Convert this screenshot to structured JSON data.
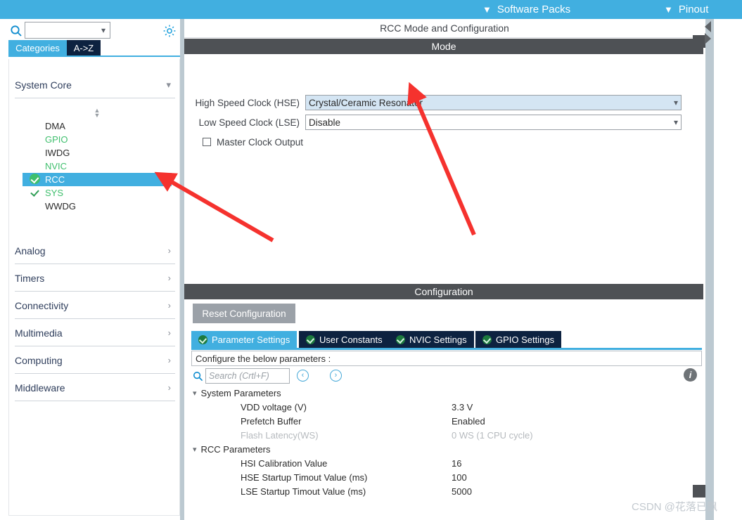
{
  "colors": {
    "accent_blue": "#41afe0",
    "tab_navy": "#0d2240",
    "header_dark": "#4e5155",
    "green": "#3fbf6d",
    "annotation_red": "#f5322e",
    "selected_field": "#d4e5f3"
  },
  "topbar": {
    "items": [
      {
        "label": "Software Packs",
        "icon": "chevron-down-icon"
      },
      {
        "label": "Pinout",
        "icon": "chevron-down-icon"
      }
    ]
  },
  "sidebar": {
    "search": {
      "value": "",
      "placeholder": "",
      "icon": "search-icon"
    },
    "settings_icon": "gear-icon",
    "tabs": [
      {
        "label": "Categories",
        "active": true
      },
      {
        "label": "A->Z",
        "active": false
      }
    ],
    "groups": [
      {
        "label": "System Core",
        "expanded": true,
        "icon": "chevron-down-icon"
      },
      {
        "label": "Analog",
        "expanded": false,
        "icon": "chevron-right-icon"
      },
      {
        "label": "Timers",
        "expanded": false,
        "icon": "chevron-right-icon"
      },
      {
        "label": "Connectivity",
        "expanded": false,
        "icon": "chevron-right-icon"
      },
      {
        "label": "Multimedia",
        "expanded": false,
        "icon": "chevron-right-icon"
      },
      {
        "label": "Computing",
        "expanded": false,
        "icon": "chevron-right-icon"
      },
      {
        "label": "Middleware",
        "expanded": false,
        "icon": "chevron-right-icon"
      }
    ],
    "peripherals": [
      {
        "label": "DMA",
        "state": "none",
        "selected": false
      },
      {
        "label": "GPIO",
        "state": "configured",
        "selected": false
      },
      {
        "label": "IWDG",
        "state": "none",
        "selected": false
      },
      {
        "label": "NVIC",
        "state": "configured",
        "selected": false
      },
      {
        "label": "RCC",
        "state": "badge-check",
        "selected": true
      },
      {
        "label": "SYS",
        "state": "plain-check",
        "selected": false
      },
      {
        "label": "WWDG",
        "state": "none",
        "selected": false
      }
    ]
  },
  "main": {
    "title": "RCC Mode and Configuration",
    "mode": {
      "header": "Mode",
      "fields": [
        {
          "label": "High Speed Clock (HSE)",
          "value": "Crystal/Ceramic Resonator",
          "active": true,
          "icon": "chevron-down-icon"
        },
        {
          "label": "Low Speed Clock (LSE)",
          "value": "Disable",
          "active": false,
          "icon": "chevron-down-icon"
        }
      ],
      "checkbox": {
        "label": "Master Clock Output",
        "checked": false
      }
    },
    "configuration": {
      "header": "Configuration",
      "reset_button": "Reset Configuration",
      "tabs": [
        {
          "label": "Parameter Settings",
          "active": true,
          "icon": "green-check-icon"
        },
        {
          "label": "User Constants",
          "active": false,
          "icon": "green-check-icon"
        },
        {
          "label": "NVIC Settings",
          "active": false,
          "icon": "green-check-icon"
        },
        {
          "label": "GPIO Settings",
          "active": false,
          "icon": "green-check-icon"
        }
      ],
      "note": "Configure the below parameters :",
      "search": {
        "placeholder": "Search (Crtl+F)",
        "value": "",
        "icon": "search-icon"
      },
      "nav_prev": "‹",
      "nav_next": "›",
      "info_icon": "info-icon",
      "info_letter": "i",
      "parameters": [
        {
          "type": "category",
          "label": "System Parameters",
          "expanded": true
        },
        {
          "type": "row",
          "name": "VDD voltage (V)",
          "value": "3.3 V",
          "dim": false
        },
        {
          "type": "row",
          "name": "Prefetch Buffer",
          "value": "Enabled",
          "dim": false
        },
        {
          "type": "row",
          "name": "Flash Latency(WS)",
          "value": "0 WS (1 CPU cycle)",
          "dim": true
        },
        {
          "type": "category",
          "label": "RCC Parameters",
          "expanded": true
        },
        {
          "type": "row",
          "name": "HSI Calibration Value",
          "value": "16",
          "dim": false
        },
        {
          "type": "row",
          "name": "HSE Startup Timout Value (ms)",
          "value": "100",
          "dim": false
        },
        {
          "type": "row",
          "name": "LSE Startup Timout Value (ms)",
          "value": "5000",
          "dim": false
        }
      ]
    }
  },
  "watermark": "CSDN @花落已飘"
}
